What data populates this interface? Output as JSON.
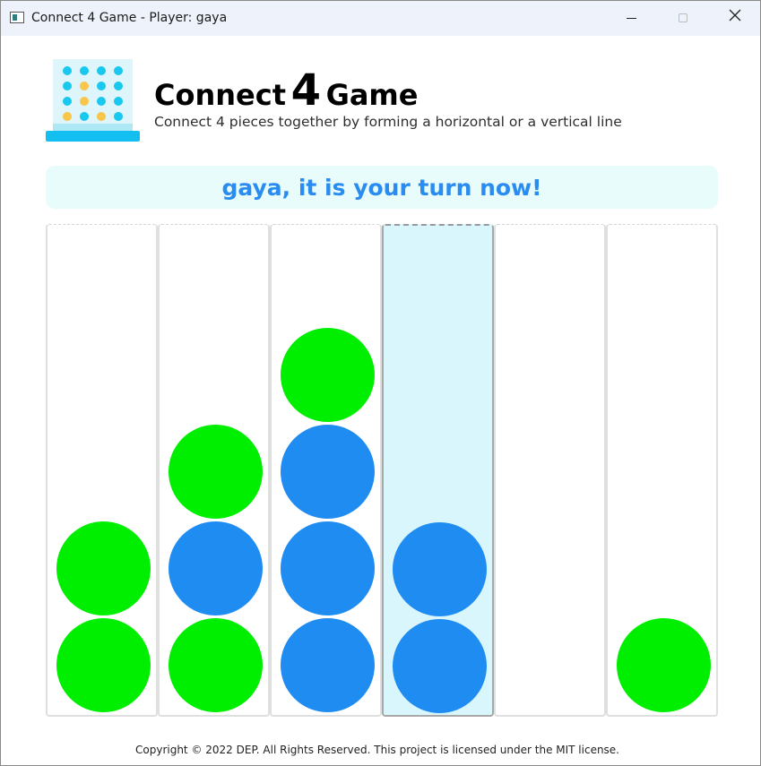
{
  "window": {
    "title": "Connect 4 Game - Player: gaya"
  },
  "header": {
    "heading_prefix": "Connect",
    "heading_number": "4",
    "heading_suffix": "Game",
    "subtitle": "Connect 4 pieces together by forming a horizontal or a vertical line",
    "logo_icon": "connect-four-board-icon"
  },
  "status": {
    "message": "gaya, it is your turn now!"
  },
  "colors": {
    "green_disc": "#00ee00",
    "blue_disc": "#1f8cf2",
    "banner_bg": "#e7fcfb",
    "banner_text": "#2a8cf0",
    "active_column_bg": "#d9f6fd"
  },
  "board": {
    "columns": 6,
    "rows": 5,
    "active_column": 4,
    "stacks": [
      [
        "green",
        "green"
      ],
      [
        "green",
        "blue",
        "green"
      ],
      [
        "blue",
        "blue",
        "blue",
        "green"
      ],
      [
        "blue",
        "blue"
      ],
      [],
      [
        "green"
      ]
    ]
  },
  "footer": {
    "copyright": "Copyright © 2022 DEP. All Rights Reserved. This project is licensed under the MIT license."
  }
}
